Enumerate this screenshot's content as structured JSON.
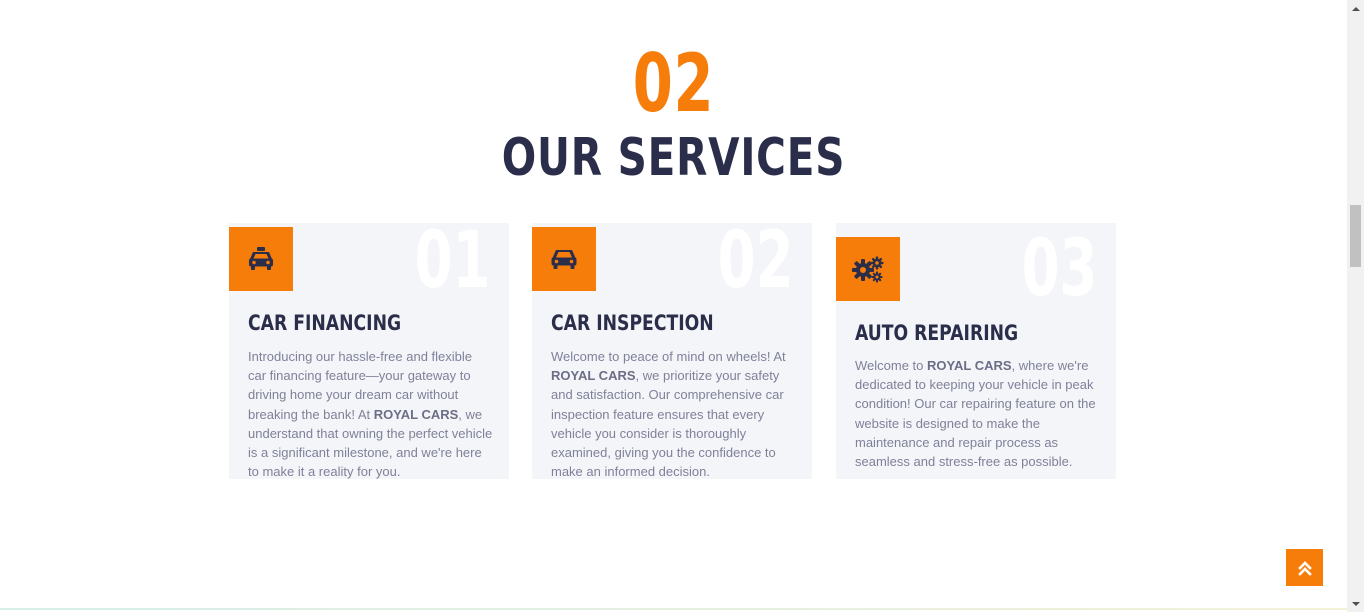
{
  "section": {
    "number": "02",
    "title": "OUR SERVICES"
  },
  "cards": [
    {
      "number": "01",
      "title": "CAR FINANCING",
      "icon": "taxi-icon",
      "text_1": "Introducing our hassle-free and flexible car financing feature—your gateway to driving home your dream car without breaking the bank! At ",
      "brand": "ROYAL CARS",
      "text_2": ", we understand that owning the perfect vehicle is a significant milestone, and we're here to make it a reality for you."
    },
    {
      "number": "02",
      "title": "CAR INSPECTION",
      "icon": "car-icon",
      "text_1": "Welcome to peace of mind on wheels! At ",
      "brand": "ROYAL CARS",
      "text_2": ", we prioritize your safety and satisfaction. Our comprehensive car inspection feature ensures that every vehicle you consider is thoroughly examined, giving you the confidence to make an informed decision."
    },
    {
      "number": "03",
      "title": "AUTO REPAIRING",
      "icon": "cogs-icon",
      "text_1": "Welcome to ",
      "brand": "ROYAL CARS",
      "text_2": ", where we're dedicated to keeping your vehicle in peak condition! Our car repairing feature on the website is designed to make the maintenance and repair process as seamless and stress-free as possible."
    }
  ],
  "controls": {
    "back_to_top_icon": "double-chevron-up-icon"
  },
  "colors": {
    "accent": "#f77d0a",
    "heading": "#2b2e4a",
    "card_bg": "#f4f5f8",
    "body_text": "#7f819a"
  }
}
